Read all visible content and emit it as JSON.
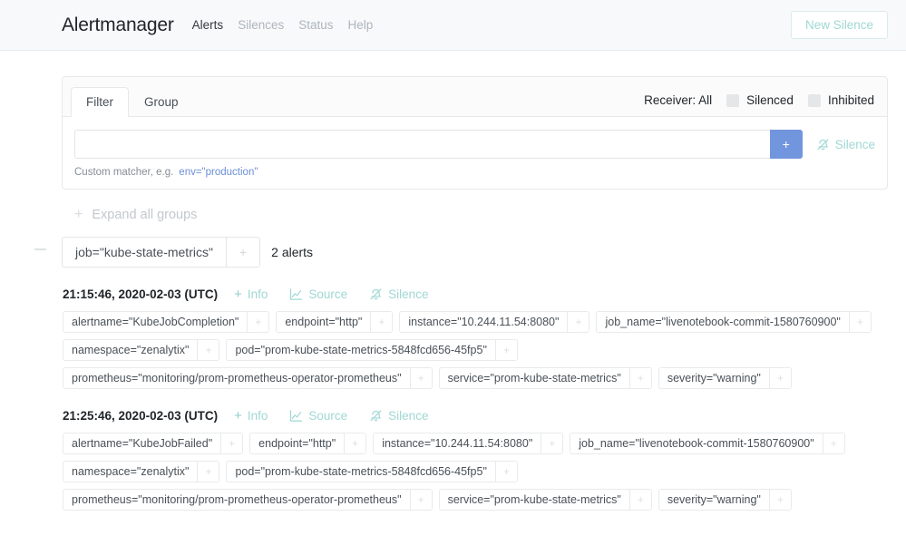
{
  "navbar": {
    "brand": "Alertmanager",
    "links": [
      {
        "label": "Alerts",
        "active": true
      },
      {
        "label": "Silences",
        "active": false
      },
      {
        "label": "Status",
        "active": false
      },
      {
        "label": "Help",
        "active": false
      }
    ],
    "new_silence_label": "New Silence"
  },
  "filter_panel": {
    "tabs": [
      {
        "label": "Filter",
        "active": true
      },
      {
        "label": "Group",
        "active": false
      }
    ],
    "receiver_label": "Receiver: All",
    "silenced_label": "Silenced",
    "inhibited_label": "Inhibited",
    "input_value": "",
    "input_placeholder": "",
    "add_button_label": "+",
    "silence_link_label": "Silence",
    "helper_text": "Custom matcher, e.g.",
    "helper_example": "env=\"production\""
  },
  "expand_all": {
    "label": "Expand all groups",
    "icon": "plus-icon"
  },
  "groups": [
    {
      "label": "job=\"kube-state-metrics\"",
      "plus_label": "+",
      "count_label": "2 alerts",
      "collapse_icon": "minus-icon",
      "alerts": [
        {
          "time": "21:15:46, 2020-02-03 (UTC)",
          "actions": [
            {
              "label": "Info",
              "icon": "plus-icon"
            },
            {
              "label": "Source",
              "icon": "chart-line-icon"
            },
            {
              "label": "Silence",
              "icon": "bell-slash-icon"
            }
          ],
          "labels": [
            "alertname=\"KubeJobCompletion\"",
            "endpoint=\"http\"",
            "instance=\"10.244.11.54:8080\"",
            "job_name=\"livenotebook-commit-1580760900\"",
            "namespace=\"zenalytix\"",
            "pod=\"prom-kube-state-metrics-5848fcd656-45fp5\"",
            "prometheus=\"monitoring/prom-prometheus-operator-prometheus\"",
            "service=\"prom-kube-state-metrics\"",
            "severity=\"warning\""
          ]
        },
        {
          "time": "21:25:46, 2020-02-03 (UTC)",
          "actions": [
            {
              "label": "Info",
              "icon": "plus-icon"
            },
            {
              "label": "Source",
              "icon": "chart-line-icon"
            },
            {
              "label": "Silence",
              "icon": "bell-slash-icon"
            }
          ],
          "labels": [
            "alertname=\"KubeJobFailed\"",
            "endpoint=\"http\"",
            "instance=\"10.244.11.54:8080\"",
            "job_name=\"livenotebook-commit-1580760900\"",
            "namespace=\"zenalytix\"",
            "pod=\"prom-kube-state-metrics-5848fcd656-45fp5\"",
            "prometheus=\"monitoring/prom-prometheus-operator-prometheus\"",
            "service=\"prom-kube-state-metrics\"",
            "severity=\"warning\""
          ]
        }
      ]
    }
  ],
  "colors": {
    "accent_teal": "#9fd8d4",
    "accent_blue": "#7296dd",
    "navbar_bg": "#f8f9fa",
    "border": "#e6e8ea",
    "muted_text": "#adb5bd"
  }
}
